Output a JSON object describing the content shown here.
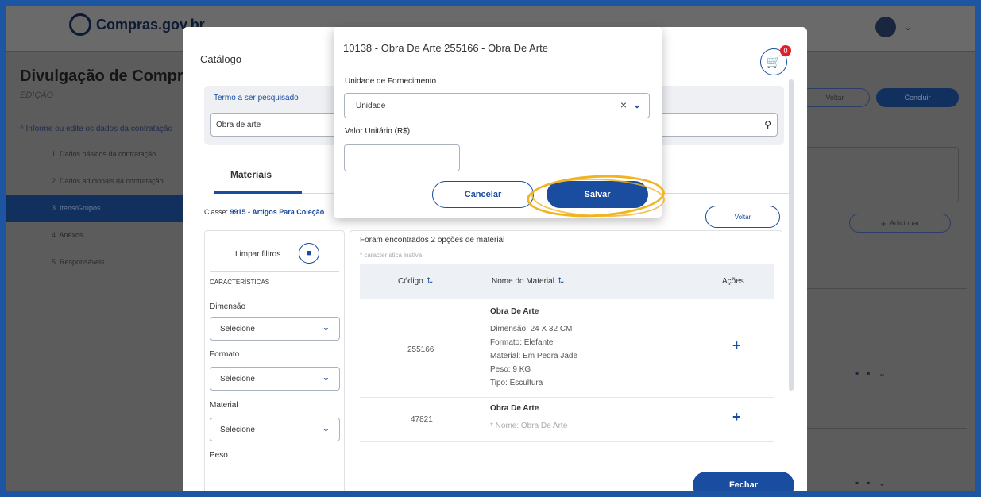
{
  "background": {
    "logo_text": "Compras.gov.br",
    "page_title": "Divulgação de Compra",
    "page_subtitle": "EDIÇÃO",
    "voltar": "Voltar",
    "concluir": "Concluir",
    "adicionar": "Adicionar",
    "section_label": "Informe ou edite os dados da contratação",
    "nav_items": [
      "1. Dados básicos da contratação",
      "2. Dados adicionais da contratação",
      "3. Itens/Grupos",
      "4. Anexos",
      "5. Responsáveis"
    ]
  },
  "modal": {
    "title": "Catálogo",
    "cart_count": "0",
    "search": {
      "label": "Termo a ser pesquisado",
      "value": "Obra de arte"
    },
    "tab": "Materiais",
    "classe_prefix": "Classe:",
    "classe_value": "9915 - Artigos Para Coleção",
    "voltar": "Voltar",
    "filters": {
      "clear_label": "Limpar filtros",
      "header": "CARACTERÍSTICAS",
      "items": [
        {
          "label": "Dimensão",
          "value": "Selecione"
        },
        {
          "label": "Formato",
          "value": "Selecione"
        },
        {
          "label": "Material",
          "value": "Selecione"
        },
        {
          "label": "Peso",
          "value": ""
        }
      ]
    },
    "results": {
      "count_text": "Foram encontrados 2 opções de material",
      "note": "* característica inativa",
      "columns": [
        "Código",
        "Nome do Material",
        "Ações"
      ],
      "rows": [
        {
          "code": "255166",
          "name": "Obra De Arte",
          "details": [
            "Dimensão: 24 X 32 CM",
            "Formato: Elefante",
            "Material: Em Pedra Jade",
            "Peso: 9 KG",
            "Tipo: Escultura"
          ]
        },
        {
          "code": "47821",
          "name": "Obra De Arte",
          "details": [
            "* Nome: Obra De Arte"
          ]
        }
      ]
    },
    "close_label": "Fechar"
  },
  "popover": {
    "title": "10138 - Obra De Arte 255166 - Obra De Arte",
    "unit_label": "Unidade de Fornecimento",
    "unit_value": "Unidade",
    "price_label": "Valor Unitário (R$)",
    "price_value": "",
    "cancel": "Cancelar",
    "save": "Salvar"
  },
  "colors": {
    "primary": "#1a4ca0",
    "badge": "#e0202c",
    "highlight": "#f0b322",
    "frame": "#1d55a3"
  }
}
